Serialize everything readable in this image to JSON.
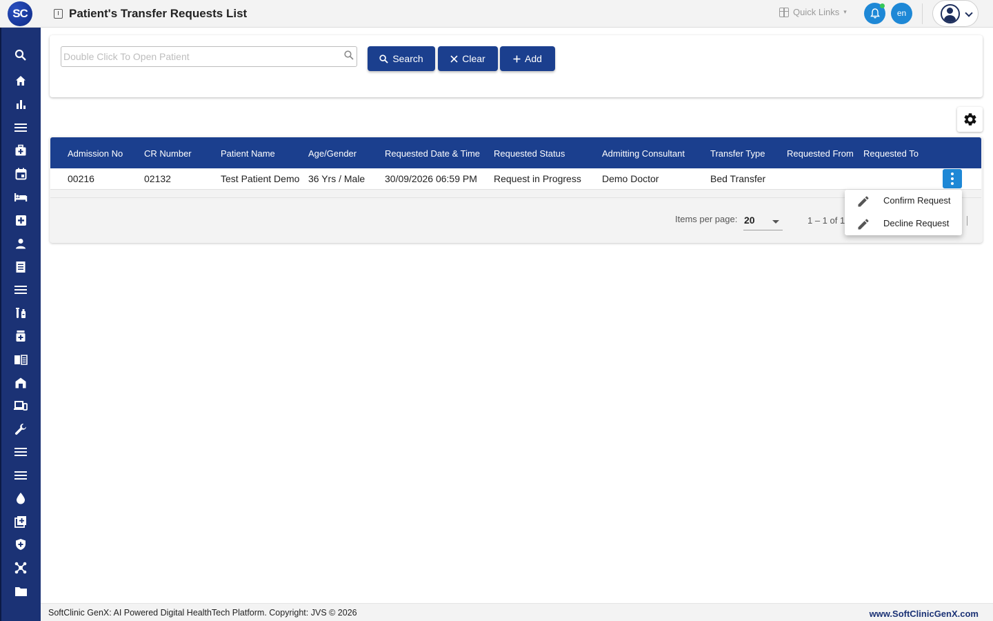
{
  "header": {
    "logo_text": "SC",
    "page_title": "Patient's Transfer Requests List",
    "quick_links_label": "Quick Links",
    "lang_label": "en"
  },
  "sidebar": {
    "items": [
      {
        "icon": "search-icon"
      },
      {
        "icon": "home-icon"
      },
      {
        "icon": "bar-chart-icon"
      },
      {
        "icon": "menu-icon"
      },
      {
        "icon": "medical-bag-icon"
      },
      {
        "icon": "calendar-icon"
      },
      {
        "icon": "bed-icon"
      },
      {
        "icon": "medical-plus-icon"
      },
      {
        "icon": "person-icon"
      },
      {
        "icon": "receipt-icon"
      },
      {
        "icon": "list-icon"
      },
      {
        "icon": "lab-icon"
      },
      {
        "icon": "pharmacy-icon"
      },
      {
        "icon": "book-icon"
      },
      {
        "icon": "store-icon"
      },
      {
        "icon": "devices-icon"
      },
      {
        "icon": "wrench-icon"
      },
      {
        "icon": "list-icon"
      },
      {
        "icon": "list-icon"
      },
      {
        "icon": "blood-drop-icon"
      },
      {
        "icon": "add-box-icon"
      },
      {
        "icon": "shield-plus-icon"
      },
      {
        "icon": "network-icon"
      },
      {
        "icon": "folder-icon"
      }
    ]
  },
  "search": {
    "placeholder": "Double Click To Open Patient",
    "value": "",
    "search_label": "Search",
    "clear_label": "Clear",
    "add_label": "Add"
  },
  "table": {
    "columns": [
      "Admission No",
      "CR Number",
      "Patient Name",
      "Age/Gender",
      "Requested Date & Time",
      "Requested Status",
      "Admitting Consultant",
      "Transfer Type",
      "Requested From",
      "Requested To"
    ],
    "rows": [
      [
        "00216",
        "02132",
        "Test Patient Demo",
        "36 Yrs / Male",
        "30/09/2026 06:59 PM",
        "Request in Progress",
        "Demo Doctor",
        "Bed Transfer",
        "",
        ""
      ]
    ]
  },
  "paginator": {
    "items_per_page_label": "Items per page:",
    "items_per_page_value": "20",
    "range_label": "1 – 1 of 1"
  },
  "row_menu": {
    "items": [
      {
        "label": "Confirm Request",
        "icon": "pencil-icon"
      },
      {
        "label": "Decline Request",
        "icon": "pencil-icon"
      }
    ]
  },
  "footer": {
    "copyright": "SoftClinic GenX: AI Powered Digital HealthTech Platform. Copyright: JVS © 2026",
    "website": "www.SoftClinicGenX.com"
  },
  "colors": {
    "sidebar": "#1b3275",
    "primary_button": "#1b3f8e",
    "accent": "#1e88d6"
  }
}
